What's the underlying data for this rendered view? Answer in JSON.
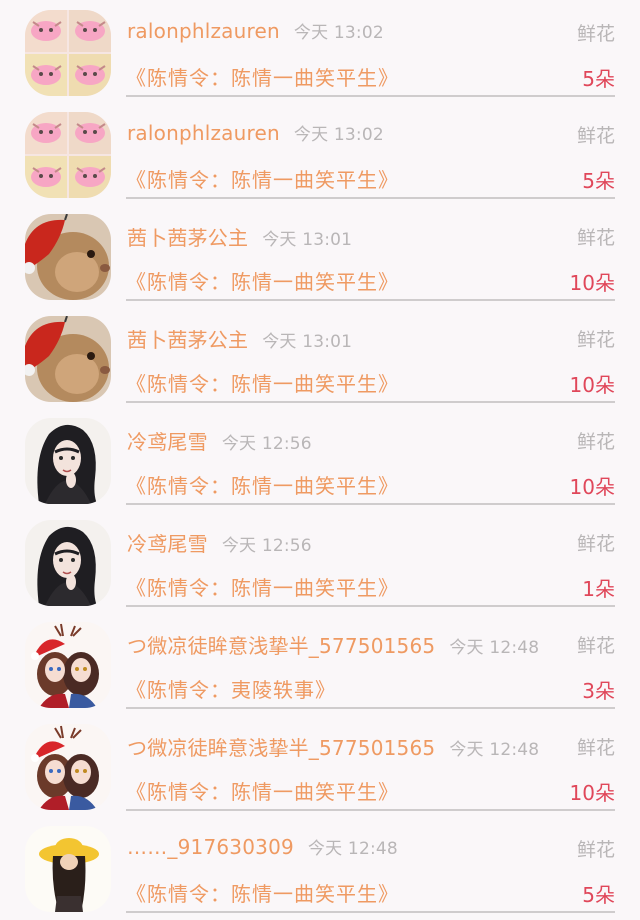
{
  "gifts": [
    {
      "avatar": "pink-cat-sticker-avatar",
      "user": "ralonphlzauren",
      "time": "今天 13:02",
      "gift": "鲜花",
      "book": "《陈情令：陈情一曲笑平生》",
      "count": "5朵"
    },
    {
      "avatar": "pink-cat-sticker-avatar",
      "user": "ralonphlzauren",
      "time": "今天 13:02",
      "gift": "鲜花",
      "book": "《陈情令：陈情一曲笑平生》",
      "count": "5朵"
    },
    {
      "avatar": "rabbit-with-red-hat-avatar",
      "user": "茜卜茜茅公主",
      "time": "今天 13:01",
      "gift": "鲜花",
      "book": "《陈情令：陈情一曲笑平生》",
      "count": "10朵"
    },
    {
      "avatar": "rabbit-with-red-hat-avatar",
      "user": "茜卜茜茅公主",
      "time": "今天 13:01",
      "gift": "鲜花",
      "book": "《陈情令：陈情一曲笑平生》",
      "count": "10朵"
    },
    {
      "avatar": "long-haired-character-avatar",
      "user": "冷鸢尾雪",
      "time": "今天 12:56",
      "gift": "鲜花",
      "book": "《陈情令：陈情一曲笑平生》",
      "count": "10朵"
    },
    {
      "avatar": "long-haired-character-avatar",
      "user": "冷鸢尾雪",
      "time": "今天 12:56",
      "gift": "鲜花",
      "book": "《陈情令：陈情一曲笑平生》",
      "count": "1朵"
    },
    {
      "avatar": "christmas-couple-avatar",
      "user": "つ微凉徒眸意浅挚半_577501565",
      "time": "今天 12:48",
      "gift": "鲜花",
      "book": "《陈情令：夷陵轶事》",
      "count": "3朵"
    },
    {
      "avatar": "christmas-couple-avatar",
      "user": "つ微凉徒眸意浅挚半_577501565",
      "time": "今天 12:48",
      "gift": "鲜花",
      "book": "《陈情令：陈情一曲笑平生》",
      "count": "10朵"
    },
    {
      "avatar": "girl-yellow-hat-avatar",
      "user": "……_917630309",
      "time": "今天 12:48",
      "gift": "鲜花",
      "book": "《陈情令：陈情一曲笑平生》",
      "count": "5朵"
    }
  ]
}
